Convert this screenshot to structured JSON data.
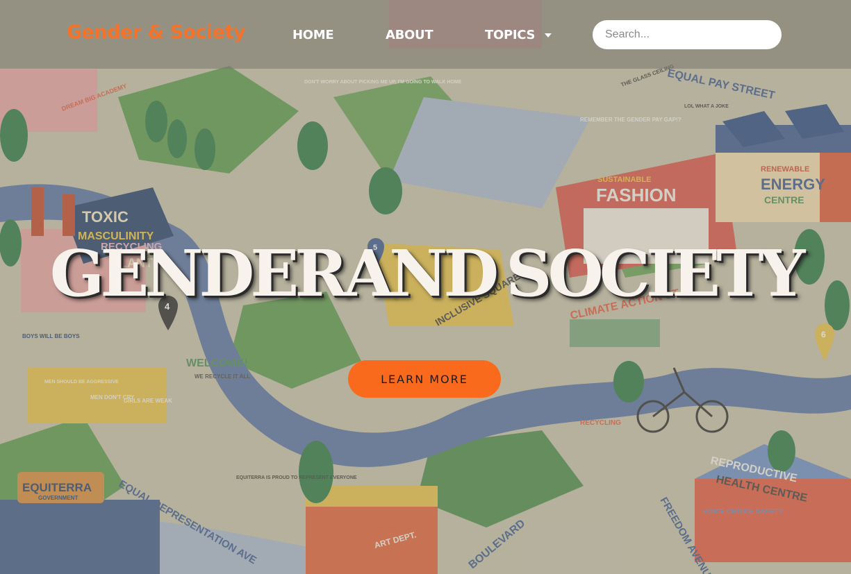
{
  "header": {
    "brand": "Gender & Society",
    "nav": {
      "home": "HOME",
      "about": "ABOUT",
      "topics": "TOPICS"
    },
    "search": {
      "placeholder": "Search..."
    }
  },
  "hero": {
    "title": "GENDERAND SOCIETY",
    "cta_label": "LEARN MORE"
  },
  "map_labels": {
    "toxic": "TOXIC",
    "masculinity": "MASCULINITY",
    "recycling": "RECYCLING",
    "plant": "PLANT",
    "fashion_tag": "SUSTAINABLE",
    "fashion": "FASHION",
    "renewable": "RENEWABLE",
    "energy": "ENERGY",
    "centre": "CENTRE",
    "equal_pay": "EQUAL PAY STREET",
    "glass_ceiling": "THE GLASS CEILING",
    "remember": "REMEMBER THE GENDER PAY GAP!?",
    "lol": "LOL WHAT A JOKE",
    "welcome": "WELCOME!",
    "we_recycle": "WE RECYCLE IT ALL",
    "inclusive": "INCLUSIVE SQUARE",
    "climate": "CLIMATE ACTION ST",
    "recycling_cart": "RECYCLING",
    "equiterra": "EQUITERRA",
    "government": "GOVERNMENT",
    "equal_rep": "EQUAL REPRESENTATION AVE",
    "equiterra_proud": "EQUITERRA IS PROUD TO REPRESENT EVERYONE",
    "boulevard": "BOULEVARD",
    "art_dept": "ART DEPT.",
    "freedom": "FREEDOM AVENUE",
    "reproductive": "REPRODUCTIVE",
    "health_centre": "HEALTH CENTRE",
    "voice_choice": "VOICE CHOICE SAFETY",
    "dream_big": "DREAM BIG ACADEMY",
    "boys": "BOYS WILL BE BOYS",
    "men_bin": "MEN DON'T CRY",
    "girls_bin": "GIRLS ARE WEAK",
    "should_be": "MEN SHOULD BE AGGRESSIVE",
    "dont_worry": "DON'T WORRY ABOUT PICKING ME UP, I'M GOING TO WALK HOME",
    "marker_4": "4",
    "marker_5": "5",
    "marker_6": "6"
  },
  "colors": {
    "brand": "#f4732b",
    "cta": "#fa6a1c",
    "road": "#5a74a6",
    "grass": "#4e8a4a"
  }
}
